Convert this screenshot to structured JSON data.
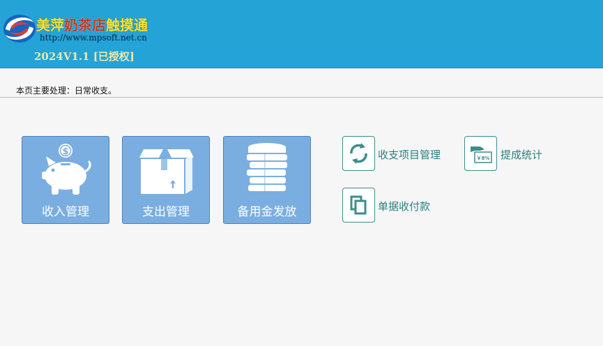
{
  "header": {
    "brand": {
      "part1": "美萍",
      "part2": "奶茶店",
      "part3": "触摸通"
    },
    "url": "http://www.mpsoft.net.cn",
    "version": "2024V1.1 [已授权]"
  },
  "page": {
    "description": "本页主要处理：日常收支。"
  },
  "tiles": [
    {
      "label": "收入管理",
      "icon": "piggy-bank-icon"
    },
    {
      "label": "支出管理",
      "icon": "box-icon"
    },
    {
      "label": "备用金发放",
      "icon": "coin-stack-icon"
    }
  ],
  "shortcuts": [
    {
      "label": "收支项目管理",
      "icon": "refresh-cycle-icon"
    },
    {
      "label": "提成统计",
      "icon": "percent-hand-icon",
      "icon_text": "￥8%"
    },
    {
      "label": "单据收付款",
      "icon": "copy-documents-icon"
    }
  ],
  "colors": {
    "header_bg": "#23a3d6",
    "tile_bg": "#7aaee0",
    "shortcut_accent": "#2b7f7f",
    "brand_yellow": "#f2e33a",
    "brand_red": "#c0392b"
  }
}
